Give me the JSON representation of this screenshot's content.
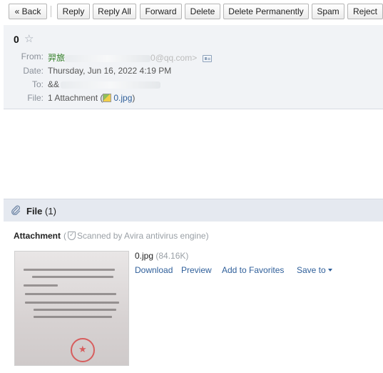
{
  "toolbar": {
    "back": "« Back",
    "reply": "Reply",
    "reply_all": "Reply All",
    "forward": "Forward",
    "delete": "Delete",
    "delete_permanently": "Delete Permanently",
    "spam": "Spam",
    "reject": "Reject"
  },
  "message": {
    "subject": "0",
    "from_label": "From:",
    "from_name": "羿旅",
    "from_addr_tail": "0@qq.com>",
    "date_label": "Date:",
    "date_value": "Thursday, Jun 16, 2022 4:19 PM",
    "to_label": "To:",
    "to_name": "&&",
    "files_label": "File:",
    "attachment_summary": "1 Attachment (",
    "attachment_file": "0.jpg",
    "attachment_close": ")"
  },
  "files_section": {
    "title": "File",
    "count": "(1)"
  },
  "attachment": {
    "label": "Attachment",
    "scan_open": "(",
    "scan_text": "Scanned by Avira antivirus engine)",
    "filename": "0.jpg",
    "size": "(84.16K)",
    "download": "Download",
    "preview": "Preview",
    "add_fav": "Add to Favorites",
    "save_to": "Save to"
  },
  "colors": {
    "accent_link": "#2f5f9a",
    "sender_green": "#2b7a1e",
    "header_bg": "#f1f3f6",
    "section_bg": "#e5e9f0"
  },
  "icons": [
    "star-icon",
    "contact-card-icon",
    "jpg-file-icon",
    "paperclip-icon",
    "shield-check-icon",
    "caret-down-icon"
  ]
}
